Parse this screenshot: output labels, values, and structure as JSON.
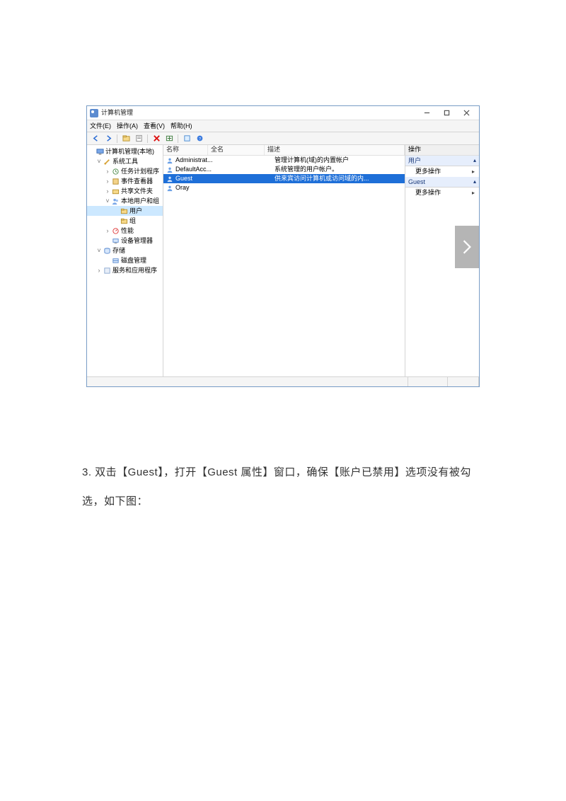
{
  "window": {
    "title": "计算机管理",
    "menu": {
      "file": "文件(E)",
      "action": "操作(A)",
      "view": "查看(V)",
      "help": "帮助(H)"
    },
    "winbtn": {
      "min": "最小化",
      "max": "最大化",
      "close": "关闭"
    }
  },
  "tree": {
    "root": "计算机管理(本地)",
    "sys_tools": "系统工具",
    "task_sched": "任务计划程序",
    "event_viewer": "事件查看器",
    "shared_folders": "共享文件夹",
    "local_users": "本地用户和组",
    "users": "用户",
    "groups": "组",
    "perf": "性能",
    "dev_mgr": "设备管理器",
    "storage": "存储",
    "disk_mgr": "磁盘管理",
    "services": "服务和应用程序"
  },
  "list": {
    "headers": {
      "name": "名称",
      "full": "全名",
      "desc": "描述"
    },
    "rows": [
      {
        "name": "Administrat...",
        "full": "",
        "desc": "管理计算机(域)的内置帐户"
      },
      {
        "name": "DefaultAcc...",
        "full": "",
        "desc": "系统管理的用户帐户。"
      },
      {
        "name": "Guest",
        "full": "",
        "desc": "供来宾访问计算机或访问域的内..."
      },
      {
        "name": "Oray",
        "full": "",
        "desc": ""
      }
    ]
  },
  "actions": {
    "header": "操作",
    "sec1": "用户",
    "more1": "更多操作",
    "sec2": "Guest",
    "more2": "更多操作"
  },
  "overlay": {
    "next": "下一张"
  },
  "paragraph": "3.  双击【Guest】，打开【Guest 属性】窗口，确保【账户已禁用】选项没有被勾选，如下图："
}
